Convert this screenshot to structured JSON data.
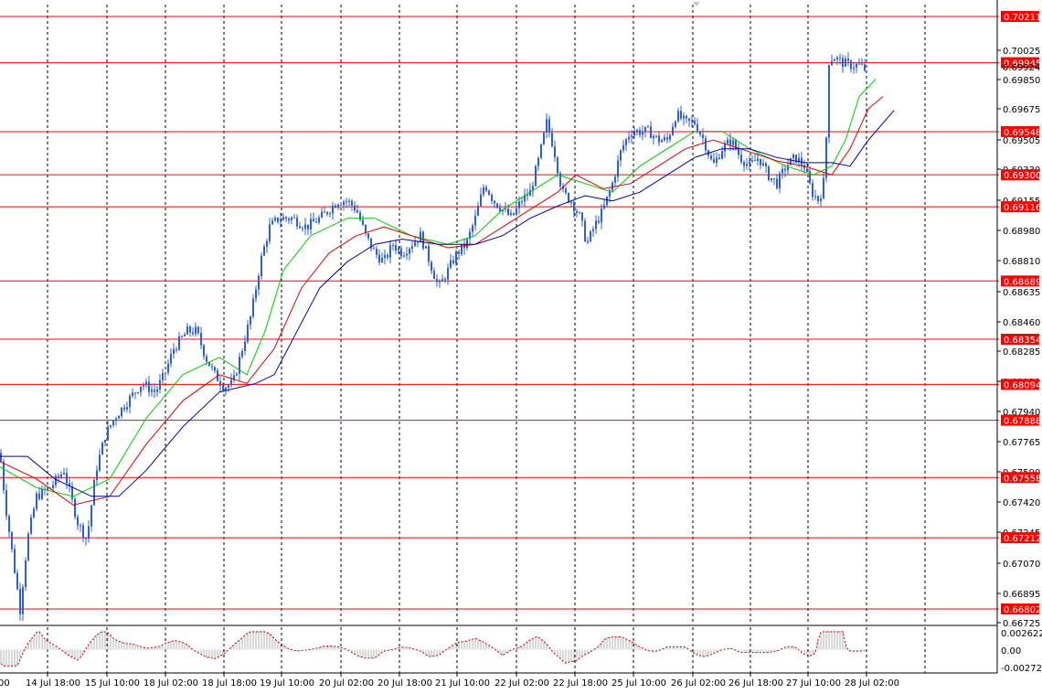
{
  "chart_data": {
    "type": "candlestick",
    "instrument_note": "",
    "main_pane": {
      "ylim": [
        0.66725,
        0.70211
      ],
      "y_ticks": [
        "0.70025",
        "0.69850",
        "0.69675",
        "0.69505",
        "0.69330",
        "0.69155",
        "0.68980",
        "0.68810",
        "0.68635",
        "0.68460",
        "0.68285",
        "0.68110",
        "0.67940",
        "0.67765",
        "0.67590",
        "0.67420",
        "0.67245",
        "0.67070",
        "0.66895",
        "0.66725"
      ],
      "current_price": "0.69924",
      "horizontal_levels": [
        {
          "label": "0.70211",
          "value": 0.70211
        },
        {
          "label": "0.69945",
          "value": 0.69945
        },
        {
          "label": "0.69548",
          "value": 0.69548
        },
        {
          "label": "0.69300",
          "value": 0.693
        },
        {
          "label": "0.69116",
          "value": 0.69116
        },
        {
          "label": "0.68689",
          "value": 0.68689
        },
        {
          "label": "0.68354",
          "value": 0.68354
        },
        {
          "label": "0.68094",
          "value": 0.68094
        },
        {
          "label": "0.67888",
          "value": 0.67888
        },
        {
          "label": "0.67558",
          "value": 0.67558
        },
        {
          "label": "0.67212",
          "value": 0.67212
        },
        {
          "label": "0.66802",
          "value": 0.66802
        }
      ],
      "price_path": [
        [
          0,
          0.677
        ],
        [
          6,
          0.674
        ],
        [
          14,
          0.671
        ],
        [
          22,
          0.668
        ],
        [
          30,
          0.672
        ],
        [
          40,
          0.6745
        ],
        [
          55,
          0.675
        ],
        [
          70,
          0.676
        ],
        [
          85,
          0.673
        ],
        [
          95,
          0.672
        ],
        [
          105,
          0.676
        ],
        [
          115,
          0.678
        ],
        [
          125,
          0.679
        ],
        [
          140,
          0.68
        ],
        [
          155,
          0.681
        ],
        [
          170,
          0.6805
        ],
        [
          180,
          0.6815
        ],
        [
          190,
          0.683
        ],
        [
          205,
          0.684
        ],
        [
          215,
          0.684
        ],
        [
          225,
          0.6825
        ],
        [
          235,
          0.6815
        ],
        [
          245,
          0.6808
        ],
        [
          255,
          0.681
        ],
        [
          265,
          0.683
        ],
        [
          275,
          0.685
        ],
        [
          285,
          0.688
        ],
        [
          295,
          0.69
        ],
        [
          305,
          0.6905
        ],
        [
          320,
          0.6905
        ],
        [
          335,
          0.69
        ],
        [
          350,
          0.6905
        ],
        [
          360,
          0.691
        ],
        [
          370,
          0.6915
        ],
        [
          380,
          0.6915
        ],
        [
          390,
          0.691
        ],
        [
          400,
          0.6895
        ],
        [
          410,
          0.6885
        ],
        [
          420,
          0.688
        ],
        [
          430,
          0.689
        ],
        [
          440,
          0.6885
        ],
        [
          450,
          0.689
        ],
        [
          460,
          0.6895
        ],
        [
          470,
          0.688
        ],
        [
          480,
          0.6865
        ],
        [
          490,
          0.6875
        ],
        [
          500,
          0.6885
        ],
        [
          510,
          0.689
        ],
        [
          520,
          0.6905
        ],
        [
          530,
          0.6925
        ],
        [
          540,
          0.6915
        ],
        [
          550,
          0.691
        ],
        [
          560,
          0.6905
        ],
        [
          570,
          0.6915
        ],
        [
          580,
          0.692
        ],
        [
          590,
          0.694
        ],
        [
          598,
          0.696
        ],
        [
          606,
          0.6945
        ],
        [
          615,
          0.692
        ],
        [
          625,
          0.6915
        ],
        [
          635,
          0.6905
        ],
        [
          642,
          0.689
        ],
        [
          650,
          0.69
        ],
        [
          660,
          0.691
        ],
        [
          670,
          0.6925
        ],
        [
          680,
          0.6945
        ],
        [
          690,
          0.6955
        ],
        [
          700,
          0.6955
        ],
        [
          710,
          0.6955
        ],
        [
          720,
          0.695
        ],
        [
          730,
          0.695
        ],
        [
          740,
          0.6965
        ],
        [
          750,
          0.696
        ],
        [
          760,
          0.696
        ],
        [
          770,
          0.695
        ],
        [
          780,
          0.6935
        ],
        [
          790,
          0.6945
        ],
        [
          800,
          0.695
        ],
        [
          810,
          0.694
        ],
        [
          820,
          0.6935
        ],
        [
          830,
          0.694
        ],
        [
          840,
          0.693
        ],
        [
          850,
          0.6925
        ],
        [
          860,
          0.6935
        ],
        [
          870,
          0.694
        ],
        [
          880,
          0.6935
        ],
        [
          888,
          0.692
        ],
        [
          896,
          0.6915
        ],
        [
          903,
          0.693
        ],
        [
          906,
          0.6995
        ],
        [
          912,
          0.6998
        ],
        [
          920,
          0.6995
        ],
        [
          930,
          0.6993
        ],
        [
          940,
          0.6993
        ],
        [
          948,
          0.699
        ]
      ],
      "moving_averages": [
        {
          "color": "#00cc00",
          "points": [
            [
              0,
              0.6762
            ],
            [
              40,
              0.675
            ],
            [
              80,
              0.6745
            ],
            [
              120,
              0.6755
            ],
            [
              160,
              0.679
            ],
            [
              200,
              0.6815
            ],
            [
              240,
              0.6825
            ],
            [
              270,
              0.6815
            ],
            [
              290,
              0.684
            ],
            [
              310,
              0.6875
            ],
            [
              340,
              0.6895
            ],
            [
              380,
              0.6905
            ],
            [
              410,
              0.6905
            ],
            [
              450,
              0.6895
            ],
            [
              490,
              0.689
            ],
            [
              520,
              0.6895
            ],
            [
              550,
              0.691
            ],
            [
              580,
              0.692
            ],
            [
              610,
              0.693
            ],
            [
              640,
              0.6925
            ],
            [
              670,
              0.692
            ],
            [
              700,
              0.6935
            ],
            [
              730,
              0.6945
            ],
            [
              760,
              0.6955
            ],
            [
              790,
              0.6955
            ],
            [
              820,
              0.6945
            ],
            [
              860,
              0.6935
            ],
            [
              890,
              0.693
            ],
            [
              910,
              0.6935
            ],
            [
              925,
              0.695
            ],
            [
              940,
              0.6975
            ],
            [
              958,
              0.6985
            ]
          ]
        },
        {
          "color": "#dd0000",
          "points": [
            [
              0,
              0.6765
            ],
            [
              40,
              0.6755
            ],
            [
              80,
              0.674
            ],
            [
              120,
              0.6745
            ],
            [
              160,
              0.6775
            ],
            [
              200,
              0.68
            ],
            [
              240,
              0.6815
            ],
            [
              270,
              0.681
            ],
            [
              300,
              0.683
            ],
            [
              330,
              0.6865
            ],
            [
              360,
              0.6885
            ],
            [
              390,
              0.6895
            ],
            [
              420,
              0.69
            ],
            [
              450,
              0.6895
            ],
            [
              490,
              0.6888
            ],
            [
              520,
              0.689
            ],
            [
              550,
              0.69
            ],
            [
              580,
              0.691
            ],
            [
              610,
              0.692
            ],
            [
              630,
              0.693
            ],
            [
              660,
              0.6922
            ],
            [
              690,
              0.6925
            ],
            [
              720,
              0.6935
            ],
            [
              750,
              0.6945
            ],
            [
              780,
              0.695
            ],
            [
              810,
              0.6945
            ],
            [
              850,
              0.6938
            ],
            [
              880,
              0.6935
            ],
            [
              910,
              0.693
            ],
            [
              930,
              0.6945
            ],
            [
              950,
              0.6968
            ],
            [
              966,
              0.6975
            ]
          ]
        },
        {
          "color": "#0000aa",
          "points": [
            [
              0,
              0.6768
            ],
            [
              30,
              0.6768
            ],
            [
              60,
              0.6755
            ],
            [
              100,
              0.6745
            ],
            [
              130,
              0.6745
            ],
            [
              160,
              0.676
            ],
            [
              200,
              0.6785
            ],
            [
              240,
              0.6805
            ],
            [
              280,
              0.681
            ],
            [
              300,
              0.6815
            ],
            [
              320,
              0.6835
            ],
            [
              350,
              0.6865
            ],
            [
              380,
              0.688
            ],
            [
              410,
              0.689
            ],
            [
              440,
              0.6893
            ],
            [
              480,
              0.689
            ],
            [
              520,
              0.689
            ],
            [
              550,
              0.6895
            ],
            [
              580,
              0.6905
            ],
            [
              610,
              0.6912
            ],
            [
              640,
              0.6918
            ],
            [
              670,
              0.6915
            ],
            [
              700,
              0.692
            ],
            [
              730,
              0.693
            ],
            [
              760,
              0.694
            ],
            [
              790,
              0.6945
            ],
            [
              820,
              0.6945
            ],
            [
              850,
              0.694
            ],
            [
              880,
              0.6937
            ],
            [
              910,
              0.6937
            ],
            [
              930,
              0.6935
            ],
            [
              950,
              0.695
            ],
            [
              978,
              0.6967
            ]
          ]
        }
      ]
    },
    "sub_pane": {
      "y_ticks": [
        "0.002622",
        "0.00",
        "-0.002726"
      ],
      "ylim": [
        -0.002726,
        0.002622
      ]
    },
    "x_tick_labels": [
      "14 Jul 18:00",
      "15 Jul 10:00",
      "18 Jul 02:00",
      "18 Jul 18:00",
      "19 Jul 10:00",
      "20 Jul 02:00",
      "20 Jul 18:00",
      "21 Jul 10:00",
      "22 Jul 02:00",
      "22 Jul 18:00",
      "25 Jul 10:00",
      "26 Jul 02:00",
      "26 Jul 18:00",
      "27 Jul 10:00",
      "28 Jul 02:00"
    ],
    "x_label_left_cut": "00",
    "colors": {
      "candles": "#2f5fc8",
      "level_lines": "#ff0000",
      "level_label_bg": "#ff0000",
      "grid": "#888888",
      "osc_dashed": "#cc0000",
      "osc_hist": "#b0b0b0"
    }
  }
}
